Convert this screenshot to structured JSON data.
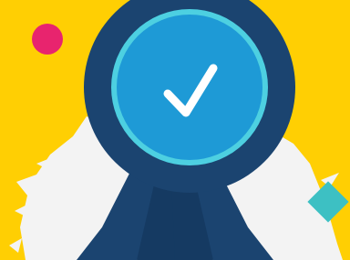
{
  "colors": {
    "background": "#FFCF03",
    "splash": "#F3F3F3",
    "dot": "#E8246E",
    "diamond": "#3DC0C3",
    "medal_outer": "#1B4470",
    "medal_inner": "#1E9AD6",
    "medal_ring": "#4DD0E1",
    "ribbon": "#1B4470",
    "ribbon_shade": "#153A62",
    "check": "#FFFFFF"
  },
  "icons": {
    "badge": "award-medal-icon",
    "check": "checkmark-icon",
    "dot": "circle-dot-icon",
    "diamond": "diamond-icon"
  }
}
